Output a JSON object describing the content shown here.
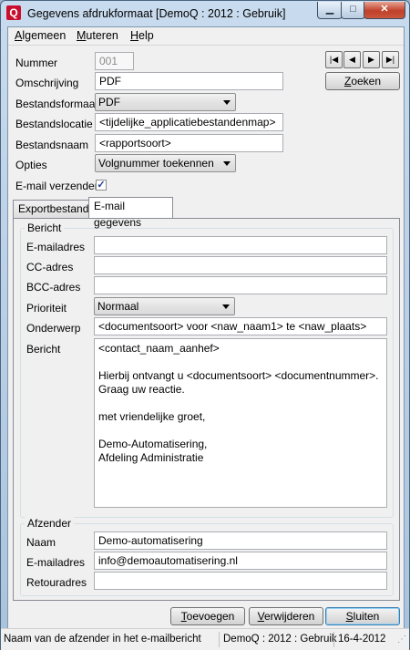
{
  "window": {
    "title": "Gegevens afdrukformaat  [DemoQ : 2012 : Gebruik]",
    "icon": "app-logo-icon"
  },
  "menu": [
    {
      "pre": "",
      "u": "A",
      "post": "lgemeen"
    },
    {
      "pre": "",
      "u": "M",
      "post": "uteren"
    },
    {
      "pre": "",
      "u": "H",
      "post": "elp"
    }
  ],
  "fields": {
    "nummer": {
      "label": "Nummer",
      "value": "001"
    },
    "omschrijving": {
      "label": "Omschrijving",
      "value": "PDF"
    },
    "bestandsformaat": {
      "label": "Bestandsformaat",
      "value": "PDF"
    },
    "bestandslocatie": {
      "label": "Bestandslocatie",
      "value": "<tijdelijke_applicatiebestandenmap>"
    },
    "bestandsnaam": {
      "label": "Bestandsnaam",
      "value": "<rapportsoort>"
    },
    "opties": {
      "label": "Opties",
      "value": "Volgnummer toekennen"
    },
    "email_verzenden": {
      "label": "E-mail verzenden",
      "checked": true
    }
  },
  "nav": {
    "zoeken_pre": "",
    "zoeken_u": "Z",
    "zoeken_post": "oeken"
  },
  "tabs": [
    {
      "label": "Exportbestand",
      "active": false
    },
    {
      "label": "E-mail gegevens",
      "active": true
    }
  ],
  "bericht": {
    "group_title": "Bericht",
    "emailadres": {
      "label": "E-mailadres",
      "value": ""
    },
    "cc": {
      "label": "CC-adres",
      "value": ""
    },
    "bcc": {
      "label": "BCC-adres",
      "value": ""
    },
    "prioriteit": {
      "label": "Prioriteit",
      "value": "Normaal"
    },
    "onderwerp": {
      "label": "Onderwerp",
      "value": "<documentsoort> voor <naw_naam1> te <naw_plaats>"
    },
    "bericht_label": "Bericht",
    "body_lines": [
      " <contact_naam_aanhef>",
      "",
      "Hierbij ontvangt u <documentsoort> <documentnummer>.",
      "Graag uw reactie.",
      "",
      "met vriendelijke groet,",
      "",
      "Demo-Automatisering,",
      "Afdeling Administratie"
    ]
  },
  "afzender": {
    "group_title": "Afzender",
    "naam": {
      "label": "Naam",
      "value": "Demo-automatisering"
    },
    "emailadres": {
      "label": "E-mailadres",
      "value": "info@demoautomatisering.nl"
    },
    "retouradres": {
      "label": "Retouradres",
      "value": ""
    }
  },
  "buttons": {
    "toevoegen": {
      "u": "T",
      "post": "oevoegen"
    },
    "verwijderen": {
      "u": "V",
      "post": "erwijderen"
    },
    "sluiten": {
      "u": "S",
      "post": "luiten"
    }
  },
  "status": {
    "hint": "Naam van de afzender in het e-mailbericht",
    "db": "DemoQ : 2012 : Gebruik",
    "date": "16-4-2012"
  }
}
